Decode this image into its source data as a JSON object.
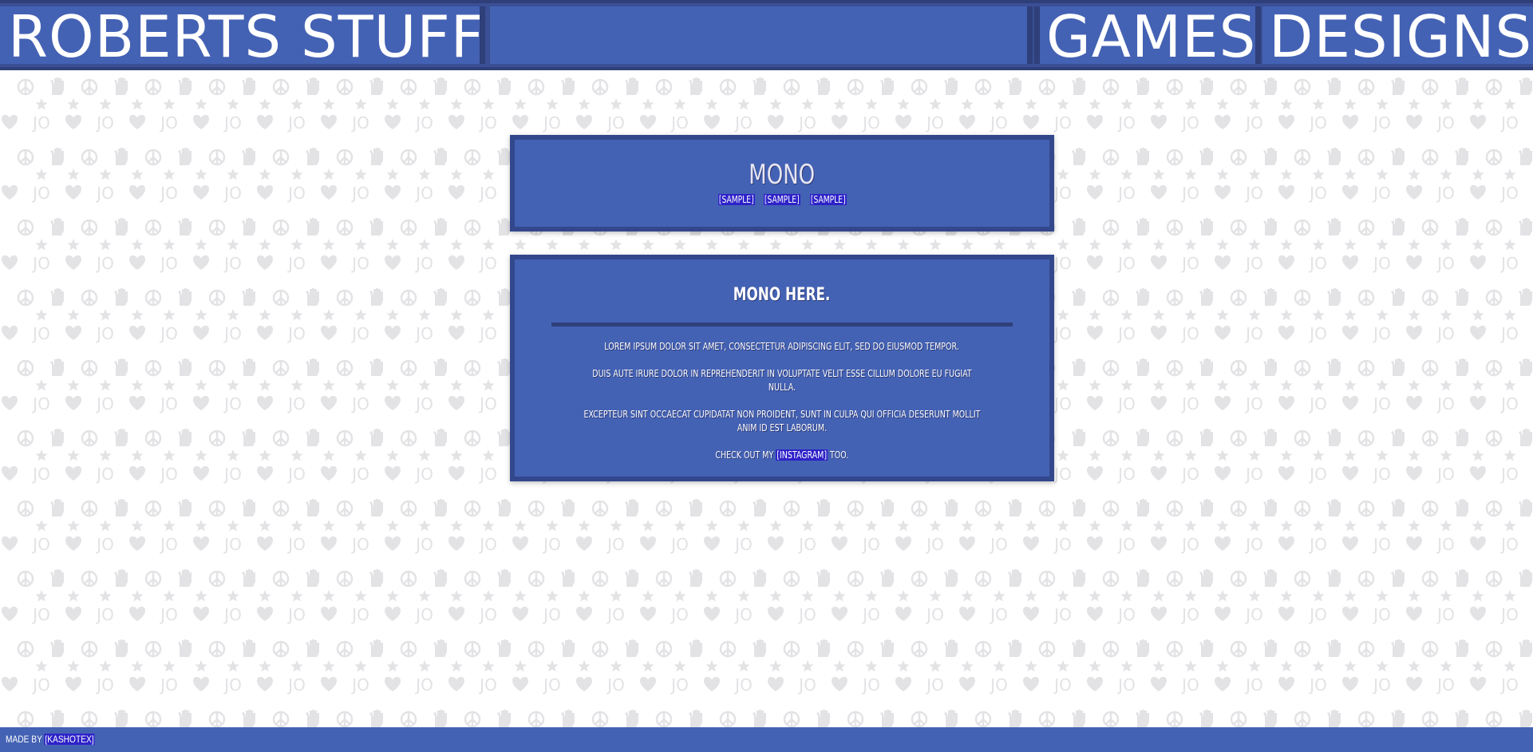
{
  "header": {
    "title": "ROBERTS STUFF",
    "nav": [
      {
        "label": "GAMES"
      },
      {
        "label": "DESIGNS"
      }
    ]
  },
  "background": {
    "pattern_icons": [
      "peace-icon",
      "hand-icon",
      "star-icon",
      "heart-icon",
      "jo-text"
    ],
    "pattern_text": "JO"
  },
  "intro_panel": {
    "title": "MONO",
    "sample_links": [
      "[SAMPLE]",
      "[SAMPLE]",
      "[SAMPLE]"
    ]
  },
  "main_panel": {
    "title": "MONO HERE.",
    "paragraphs": [
      "LOREM IPSUM DOLOR SIT AMET, CONSECTETUR ADIPISCING ELIT, SED DO EIUSMOD TEMPOR.",
      "DUIS AUTE IRURE DOLOR IN REPREHENDERIT IN VOLUPTATE VELIT ESSE CILLUM DOLORE EU FUGIAT NULLA.",
      "EXCEPTEUR SINT OCCAECAT CUPIDATAT NON PROIDENT, SUNT IN CULPA QUI OFFICIA DESERUNT MOLLIT ANIM ID EST LABORUM."
    ],
    "cta_prefix": "CHECK OUT MY ",
    "cta_link": "[INSTAGRAM]",
    "cta_suffix": " TOO."
  },
  "footer": {
    "prefix": "MADE BY ",
    "link": "[KASHOTEX]"
  },
  "colors": {
    "panel_bg": "#4462b4",
    "panel_border": "#33478c",
    "link_bg": "#2d22c8",
    "pattern": "#e3e3e6"
  }
}
